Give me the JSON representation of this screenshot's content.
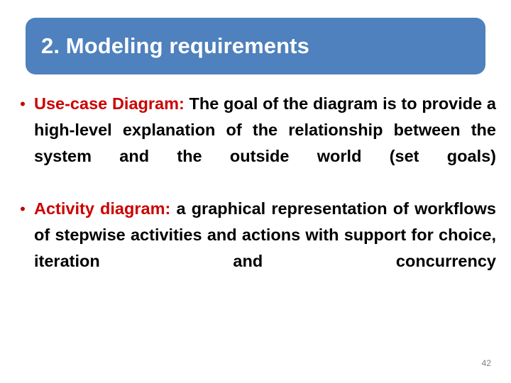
{
  "slide": {
    "title": "2. Modeling requirements",
    "title_bar_color": "#4E81BD",
    "title_text_color": "#FFFFFF",
    "background_color": "#FFFFFF",
    "accent_red": "#CC0000",
    "body_text_color": "#000000",
    "page_number": "42",
    "page_number_color": "#808080"
  },
  "bullets": [
    {
      "marker": "•",
      "lead": "Use-case Diagram:",
      "rest": " The goal of the diagram is to provide a high-level explanation of the relationship between the system and the outside world (set goals)"
    },
    {
      "marker": "•",
      "lead": "Activity diagram:",
      "rest": " a graphical representation of workflows of stepwise activities and actions with support for choice, iteration and concurrency"
    }
  ]
}
